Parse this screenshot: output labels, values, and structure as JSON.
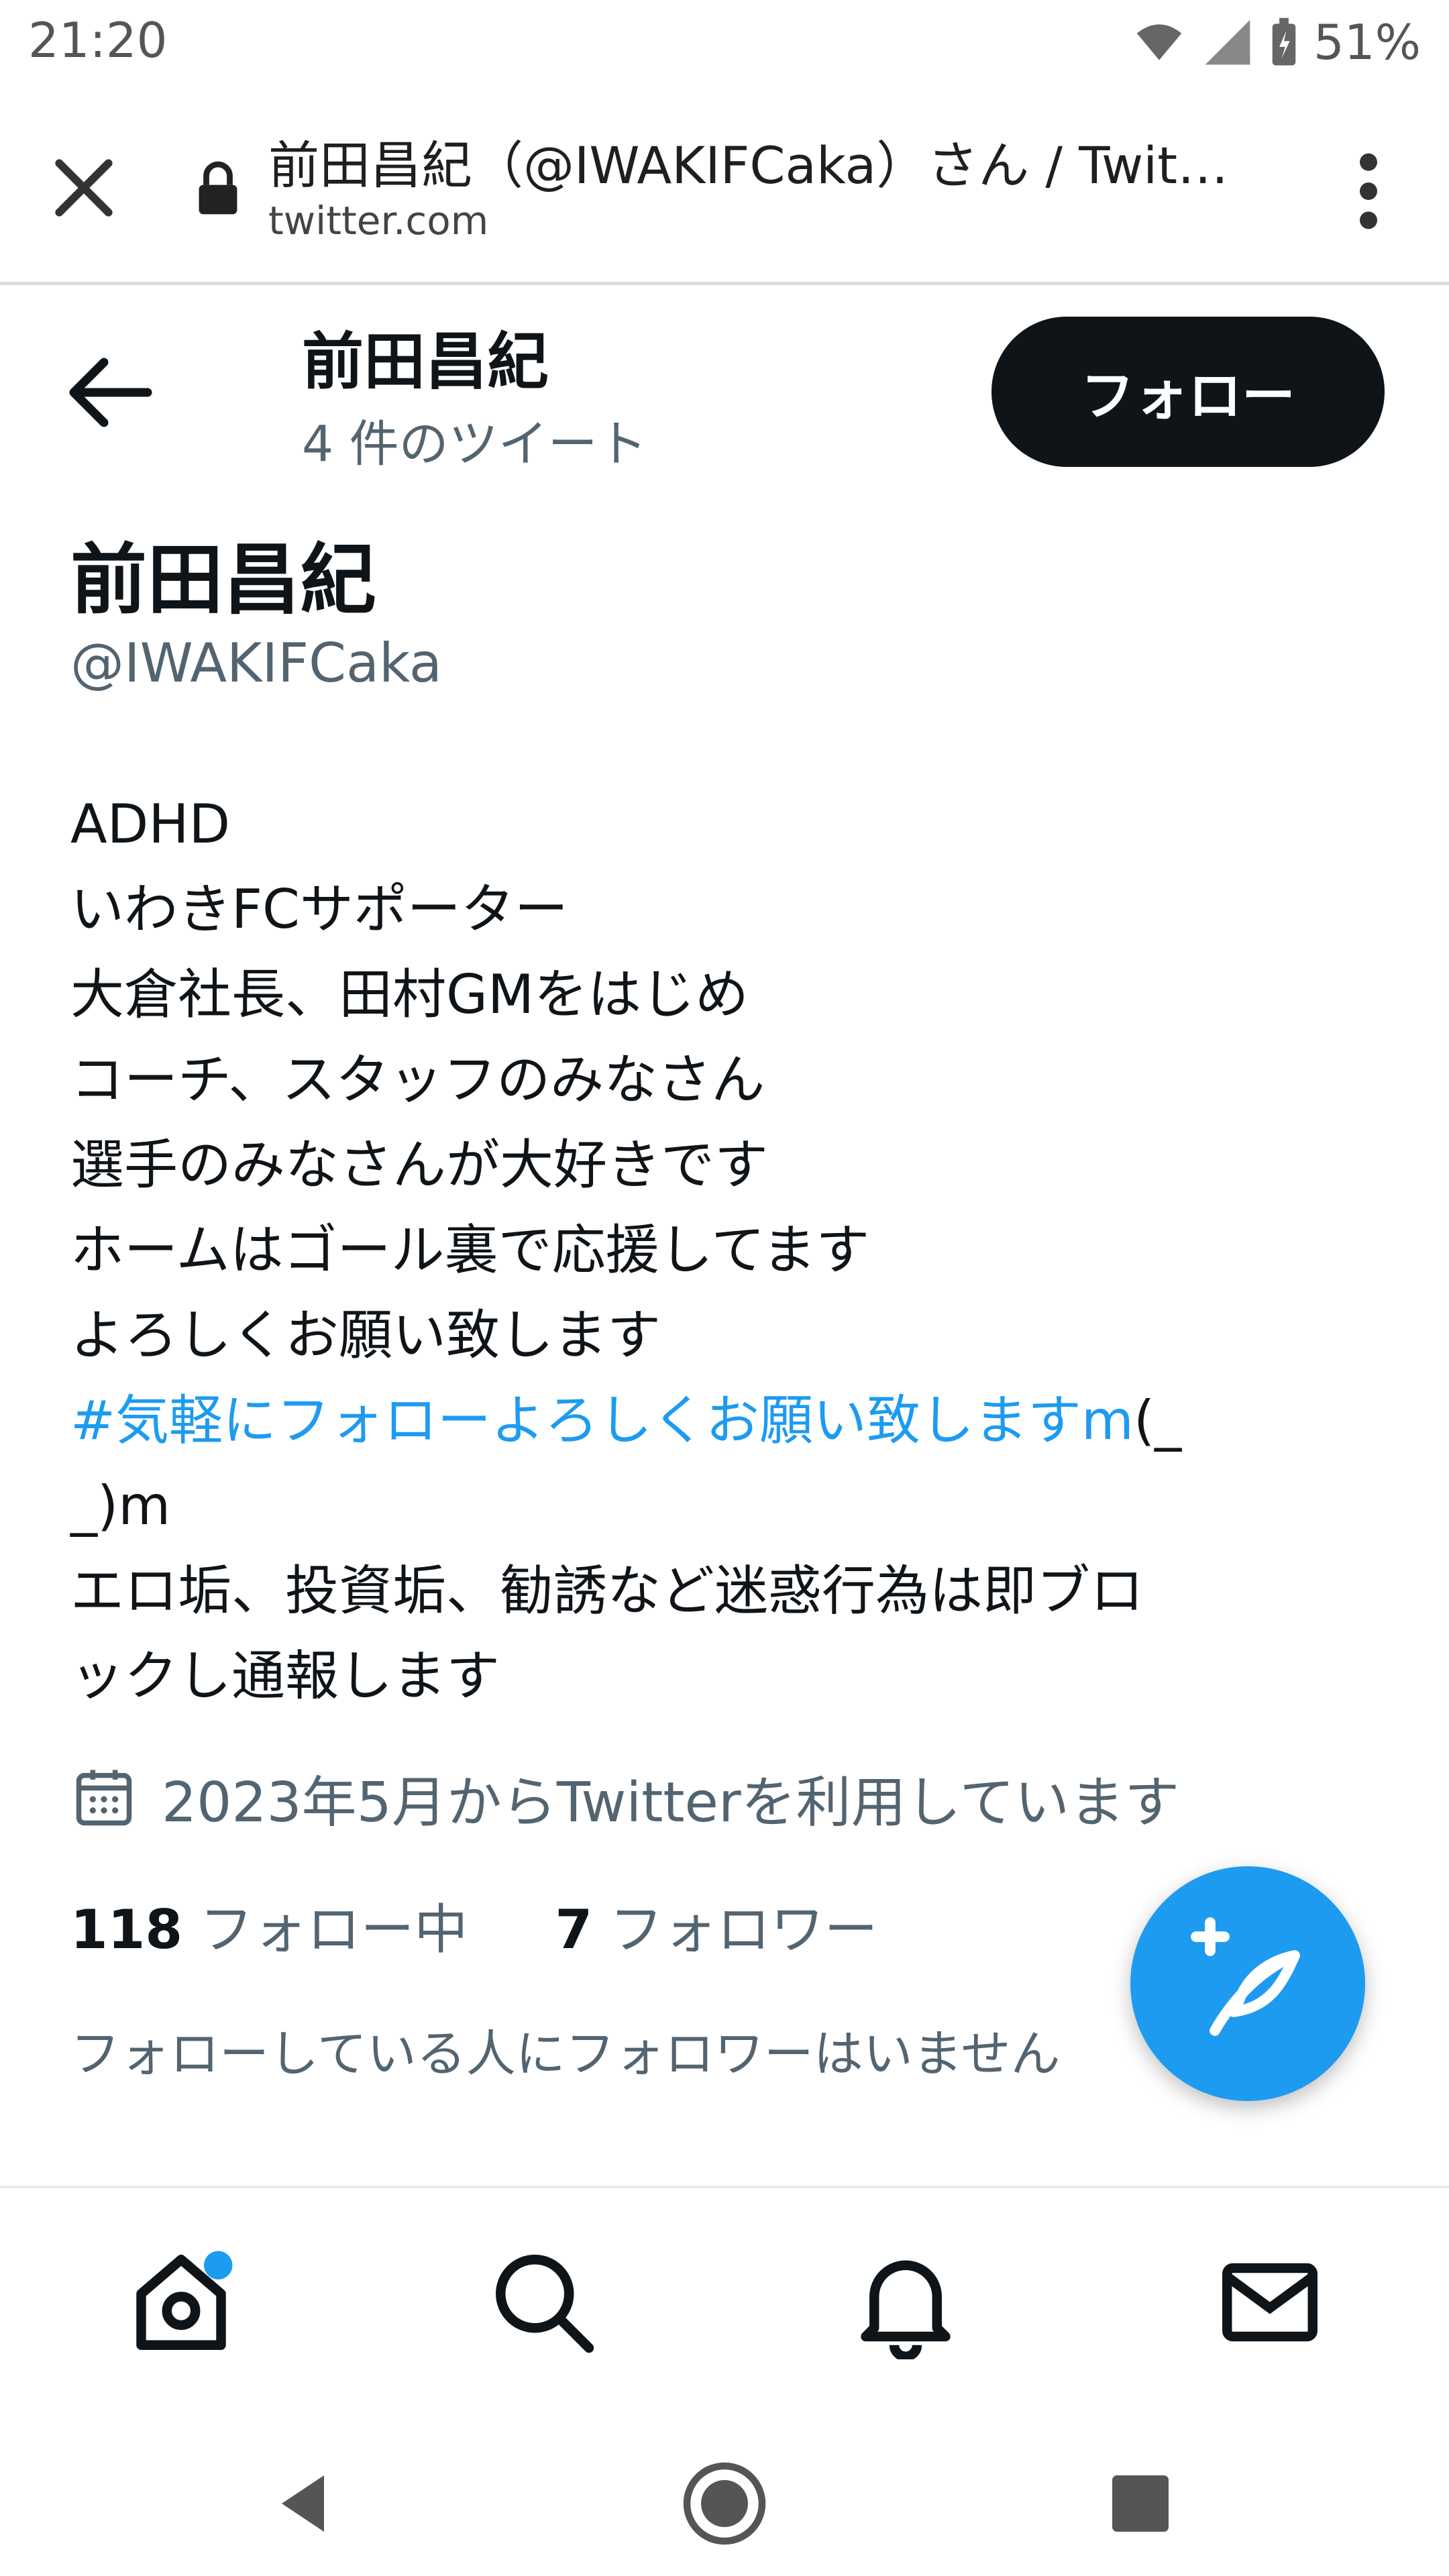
{
  "status_bar": {
    "time": "21:20",
    "battery_percent": "51%",
    "icons": [
      "wifi-icon",
      "signal-icon",
      "battery-icon"
    ]
  },
  "browser": {
    "title": "前田昌紀（@IWAKIFCaka）さん / Twit…",
    "url": "twitter.com",
    "icons": [
      "close-icon",
      "lock-icon",
      "more-vert-icon"
    ]
  },
  "header": {
    "name": "前田昌紀",
    "tweet_count": "4 件のツイート",
    "follow_label": "フォロー"
  },
  "profile": {
    "name": "前田昌紀",
    "handle": "@IWAKIFCaka",
    "bio": {
      "l1": "ADHD",
      "l2": "いわきFCサポーター",
      "l3": "大倉社長、田村GMをはじめ",
      "l4": "コーチ、スタッフのみなさん",
      "l5": "選手のみなさんが大好きです",
      "l6": "ホームはゴール裏で応援してます",
      "l7": "よろしくお願い致します",
      "hashtag": " #気軽にフォローよろしくお願い致しますm",
      "hashtag_tail": "(_",
      "l9": "_)m",
      "l10": "エロ垢、投資垢、勧誘など迷惑行為は即ブロ",
      "l11": "ックし通報します"
    },
    "joined": "2023年5月からTwitterを利用しています",
    "following_count": "118",
    "following_label": "フォロー中",
    "followers_count": "7",
    "followers_label": "フォロワー",
    "not_followed_text": "フォローしている人にフォロワーはいません"
  },
  "colors": {
    "accent": "#1d9bf0",
    "follow_bg": "#0f1419",
    "secondary_text": "#536471"
  },
  "bottom_nav": [
    "home-icon",
    "search-icon",
    "notifications-icon",
    "messages-icon"
  ],
  "system_nav": [
    "back-icon",
    "home-circle-icon",
    "recents-icon"
  ]
}
